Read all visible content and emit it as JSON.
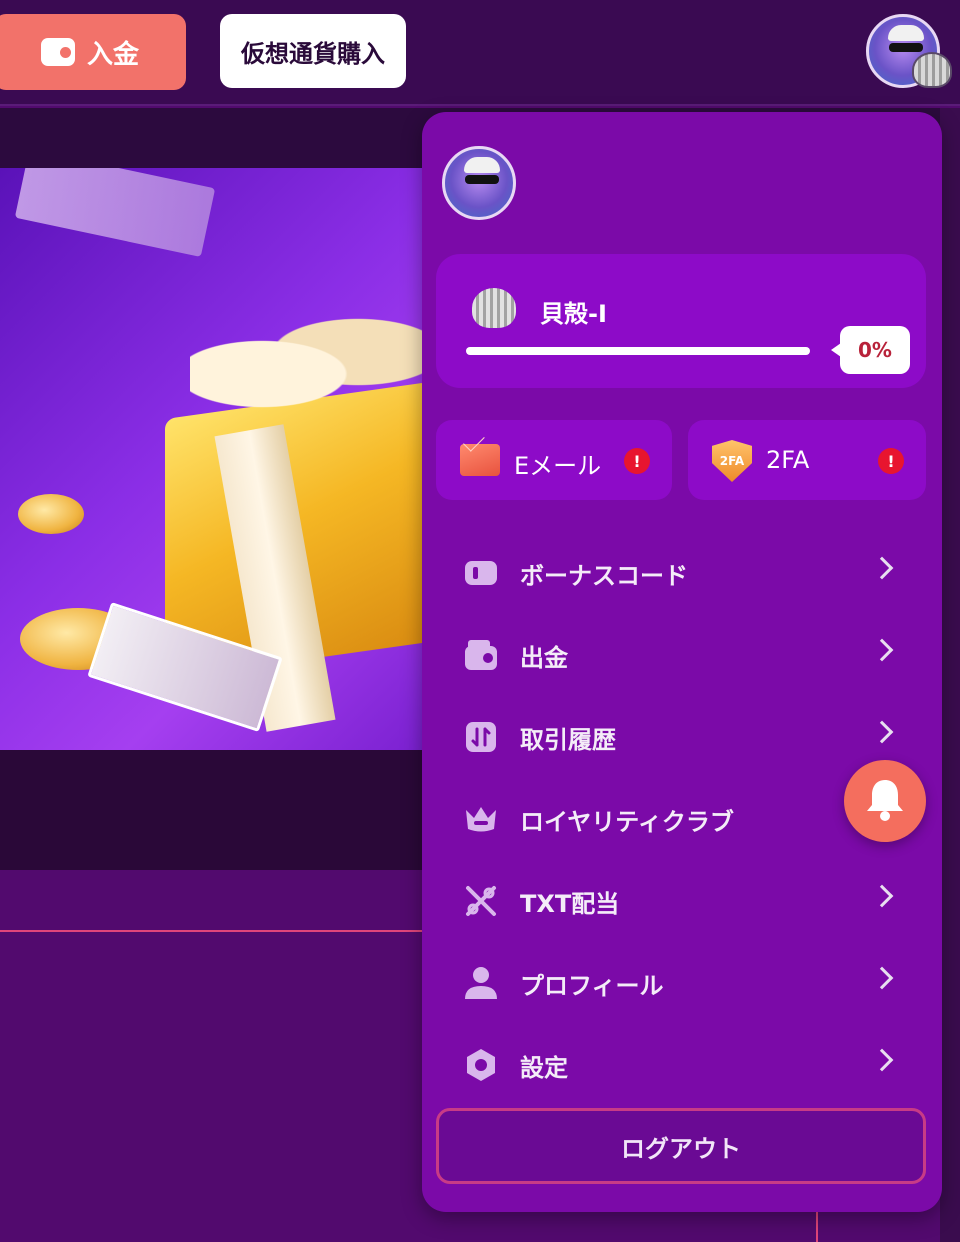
{
  "header": {
    "deposit_label": "入金",
    "buy_crypto_label": "仮想通貨購入"
  },
  "profile_menu": {
    "level": {
      "name": "貝殻-I",
      "progress_percent": 0,
      "progress_label": "0%"
    },
    "verification": [
      {
        "label": "Eメール",
        "icon": "email-icon",
        "status": "unverified"
      },
      {
        "label": "2FA",
        "icon": "2fa-shield-icon",
        "status": "unverified"
      }
    ],
    "items": [
      {
        "label": "ボーナスコード",
        "icon": "ticket-icon"
      },
      {
        "label": "出金",
        "icon": "wallet-icon"
      },
      {
        "label": "取引履歴",
        "icon": "transactions-icon"
      },
      {
        "label": "ロイヤリティクラブ",
        "icon": "crown-icon"
      },
      {
        "label": "TXT配当",
        "icon": "txt-dividend-icon"
      },
      {
        "label": "プロフィール",
        "icon": "user-icon"
      },
      {
        "label": "設定",
        "icon": "settings-hexagon-icon"
      }
    ],
    "logout_label": "ログアウト"
  },
  "colors": {
    "page_bg": "#520a6e",
    "header_bg": "#3a0a52",
    "panel_bg": "#7b0aa8",
    "card_bg": "#8d0bc8",
    "accent_coral": "#f2726a",
    "alert_red": "#e8152f",
    "logout_border": "#c83b86"
  }
}
